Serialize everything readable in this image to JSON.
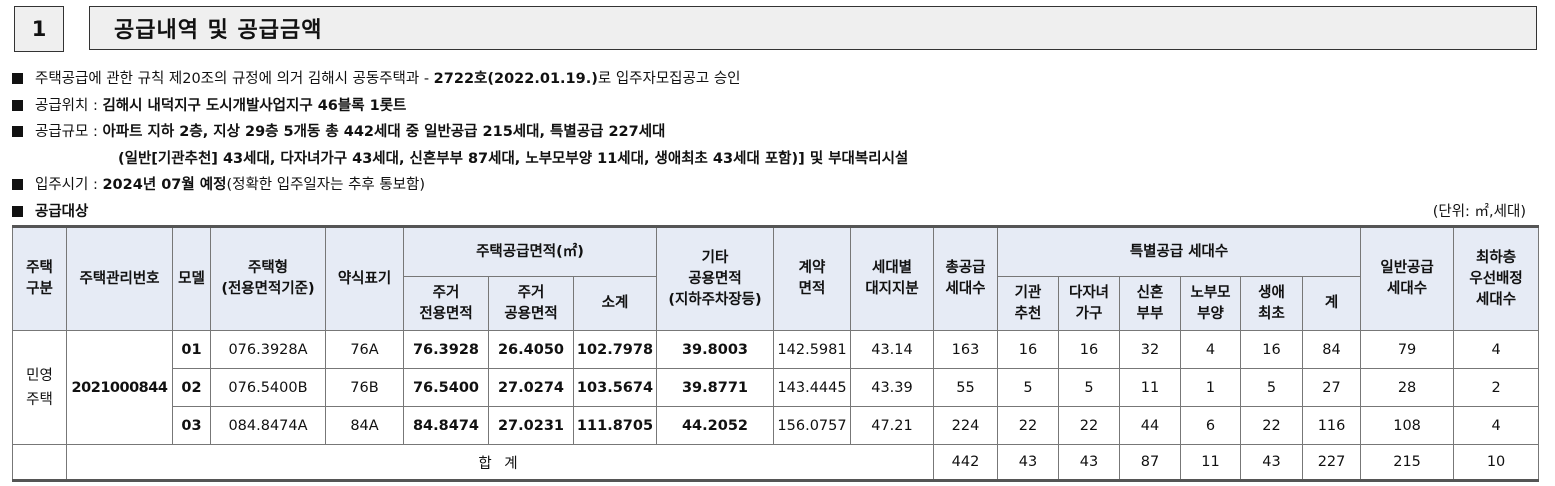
{
  "header": {
    "number": "1",
    "title": "공급내역 및 공급금액"
  },
  "info": {
    "l1_pre": "주택공급에 관한 규칙 제20조의 규정에 의거 김해시 공동주택과 - ",
    "l1_bold": "2722호(2022.01.19.)",
    "l1_post": "로 입주자모집공고 승인",
    "l2_pre": "공급위치 : ",
    "l2_bold": "김해시 내덕지구 도시개발사업지구 46블록 1롯트",
    "l3_pre": "공급규모 : ",
    "l3_bold": "아파트 지하 2층, 지상 29층 5개동 총 442세대 중 일반공급 215세대, 특별공급 227세대",
    "l4_bold": "(일반[기관추천] 43세대, 다자녀가구 43세대, 신혼부부 87세대, 노부모부양 11세대, 생애최초 43세대 포함)] 및 부대복리시설",
    "l5_pre": "입주시기 : ",
    "l5_bold": "2024년 07월 예정",
    "l5_post": "(정확한 입주일자는 추후 통보함)",
    "l6_bold": "공급대상",
    "unit": "(단위: ㎡,세대)"
  },
  "table": {
    "h": {
      "type1": "주택",
      "type2": "구분",
      "mgmt": "주택관리번호",
      "model": "모델",
      "htype1": "주택형",
      "htype2": "(전용면적기준)",
      "abbr": "약식표기",
      "supply_area": "주택공급면적(㎡)",
      "excl1": "주거",
      "excl2": "전용면적",
      "common1": "주거",
      "common2": "공용면적",
      "subtotal": "소계",
      "other1": "기타",
      "other2": "공용면적",
      "other3": "(지하주차장등)",
      "contract1": "계약",
      "contract2": "면적",
      "land1": "세대별",
      "land2": "대지지분",
      "total1": "총공급",
      "total2": "세대수",
      "special": "특별공급 세대수",
      "inst1": "기관",
      "inst2": "추천",
      "multi1": "다자녀",
      "multi2": "가구",
      "newly1": "신혼",
      "newly2": "부부",
      "parent1": "노부모",
      "parent2": "부양",
      "first1": "생애",
      "first2": "최초",
      "sum": "계",
      "general1": "일반공급",
      "general2": "세대수",
      "low1": "최하층",
      "low2": "우선배정",
      "low3": "세대수"
    },
    "kind1": "민영",
    "kind2": "주택",
    "mgmt_no": "2021000844",
    "rows": [
      {
        "model": "01",
        "type": "076.3928A",
        "abbr": "76A",
        "excl": "76.3928",
        "common": "26.4050",
        "subtotal": "102.7978",
        "other": "39.8003",
        "contract": "142.5981",
        "land": "43.14",
        "total": "163",
        "inst": "16",
        "multi": "16",
        "newly": "32",
        "parent": "4",
        "first": "16",
        "sum": "84",
        "general": "79",
        "low": "4"
      },
      {
        "model": "02",
        "type": "076.5400B",
        "abbr": "76B",
        "excl": "76.5400",
        "common": "27.0274",
        "subtotal": "103.5674",
        "other": "39.8771",
        "contract": "143.4445",
        "land": "43.39",
        "total": "55",
        "inst": "5",
        "multi": "5",
        "newly": "11",
        "parent": "1",
        "first": "5",
        "sum": "27",
        "general": "28",
        "low": "2"
      },
      {
        "model": "03",
        "type": "084.8474A",
        "abbr": "84A",
        "excl": "84.8474",
        "common": "27.0231",
        "subtotal": "111.8705",
        "other": "44.2052",
        "contract": "156.0757",
        "land": "47.21",
        "total": "224",
        "inst": "22",
        "multi": "22",
        "newly": "44",
        "parent": "6",
        "first": "22",
        "sum": "116",
        "general": "108",
        "low": "4"
      }
    ],
    "totals": {
      "label": "합 계",
      "total": "442",
      "inst": "43",
      "multi": "43",
      "newly": "87",
      "parent": "11",
      "first": "43",
      "sum": "227",
      "general": "215",
      "low": "10"
    }
  }
}
